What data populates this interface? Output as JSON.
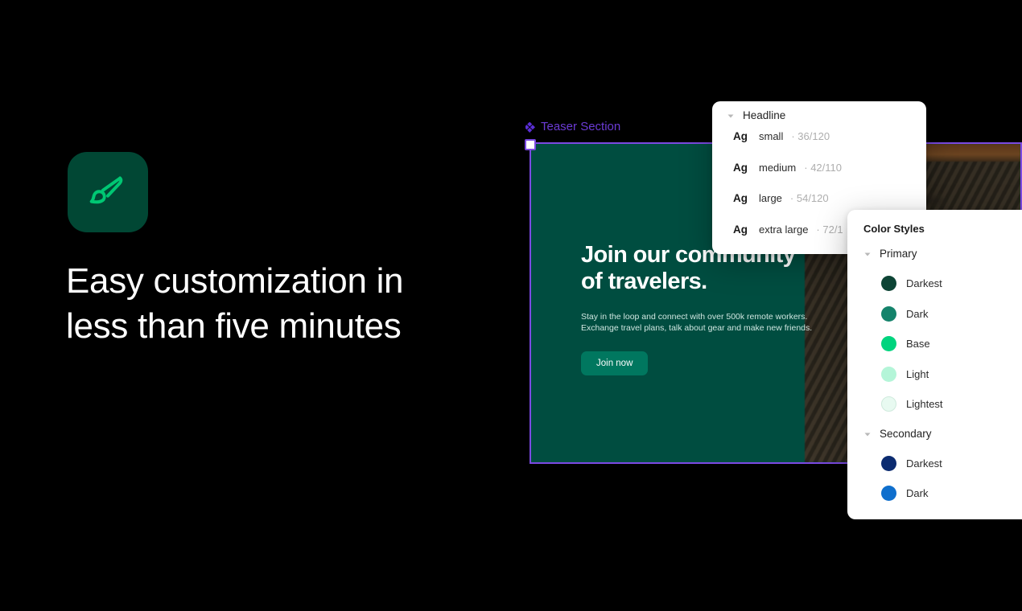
{
  "promo": {
    "icon_name": "paintbrush-icon",
    "icon_tile_color": "#014734",
    "icon_stroke_color": "#00c773",
    "heading": "Easy customization in\nless than five minutes",
    "heading_color": "#ffffff"
  },
  "canvas": {
    "background": "#000000",
    "section_label": "Teaser Section",
    "section_label_color": "#6b3bd4",
    "selection_border_color": "#7b4ae2",
    "teaser": {
      "background": "#004d40",
      "title": "Join our community\nof travelers.",
      "body": "Stay in the loop and connect with over 500k remote workers.\nExchange travel plans, talk about gear and make new friends.",
      "cta_label": "Join now",
      "cta_color": "#00775f"
    }
  },
  "type_panel": {
    "group_label": "Headline",
    "caret_state": "expanded",
    "sample_glyph": "Ag",
    "rows": [
      {
        "glyph": "Ag",
        "name": "small",
        "meta": "· 36/120"
      },
      {
        "glyph": "Ag",
        "name": "medium",
        "meta": "· 42/110"
      },
      {
        "glyph": "Ag",
        "name": "large",
        "meta": "· 54/120"
      },
      {
        "glyph": "Ag",
        "name": "extra large",
        "meta": "· 72/1"
      }
    ]
  },
  "color_panel": {
    "title": "Color Styles",
    "groups": [
      {
        "label": "Primary",
        "caret_state": "expanded",
        "swatches": [
          {
            "label": "Darkest",
            "color": "#0d4435"
          },
          {
            "label": "Dark",
            "color": "#14836b"
          },
          {
            "label": "Base",
            "color": "#00d47e"
          },
          {
            "label": "Light",
            "color": "#b4f5d8"
          },
          {
            "label": "Lightest",
            "color": "#e8faf1"
          }
        ]
      },
      {
        "label": "Secondary",
        "caret_state": "expanded",
        "swatches": [
          {
            "label": "Darkest",
            "color": "#0b2b70"
          },
          {
            "label": "Dark",
            "color": "#0f6fcd"
          }
        ]
      }
    ]
  }
}
